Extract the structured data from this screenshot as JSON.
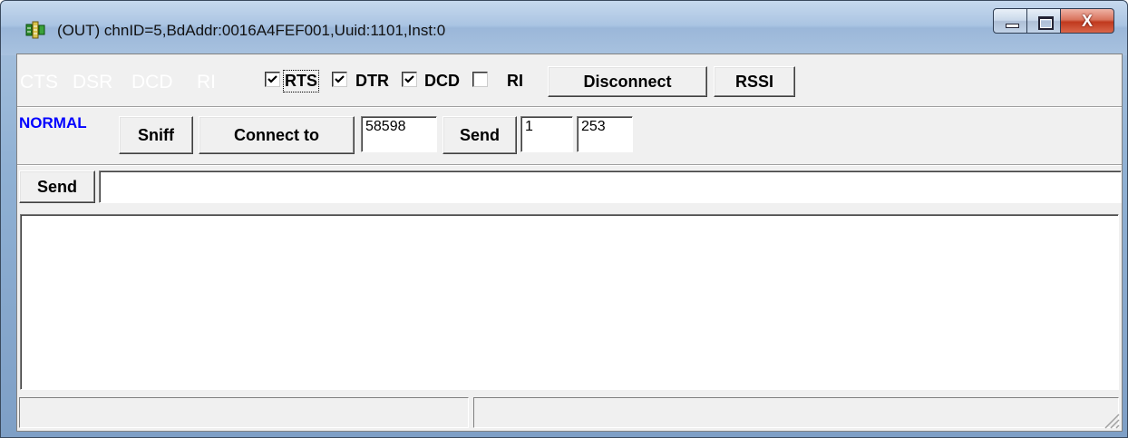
{
  "window": {
    "title": "(OUT) chnID=5,BdAddr:0016A4FEF001,Uuid:1101,Inst:0",
    "icon": "serial-port-app-icon",
    "minimize_icon": "minimize-icon",
    "maximize_icon": "maximize-icon",
    "close_icon": "close-icon",
    "close_glyph": "X"
  },
  "signals": {
    "indicators": [
      "CTS",
      "DSR",
      "DCD",
      "RI"
    ],
    "indicator_color": "#ffffff",
    "checkboxes": [
      {
        "label": "RTS",
        "checked": true
      },
      {
        "label": "DTR",
        "checked": true
      },
      {
        "label": "DCD",
        "checked": true
      },
      {
        "label": "RI",
        "checked": false
      }
    ],
    "disconnect_label": "Disconnect",
    "rssi_label": "RSSI"
  },
  "controls": {
    "mode": "NORMAL",
    "mode_color": "#0000ff",
    "sniff_label": "Sniff",
    "connect_label": "Connect to",
    "connect_value": "58598",
    "send_label": "Send",
    "send_value_1": "1",
    "send_value_2": "253"
  },
  "send_line": {
    "send_label": "Send",
    "input_value": ""
  },
  "output": {
    "text": ""
  },
  "statusbar": {
    "pane1": "",
    "pane2": ""
  }
}
